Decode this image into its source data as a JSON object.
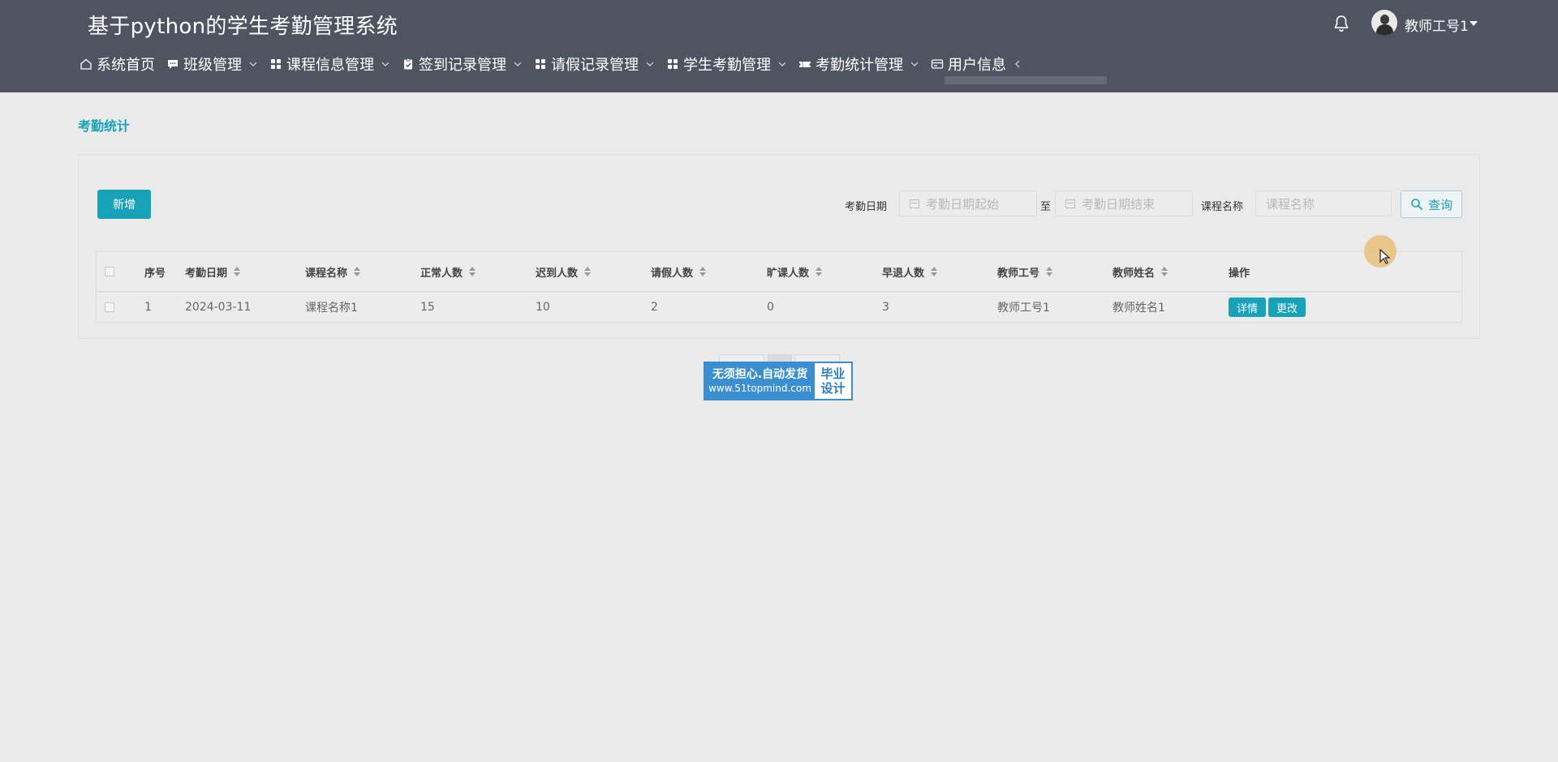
{
  "header": {
    "title": "基于python的学生考勤管理系统",
    "user_name": "教师工号1"
  },
  "nav": {
    "items": [
      {
        "label": "系统首页",
        "icon": "home-icon",
        "has_dropdown": false
      },
      {
        "label": "班级管理",
        "icon": "chat-icon",
        "has_dropdown": true
      },
      {
        "label": "课程信息管理",
        "icon": "grid-icon",
        "has_dropdown": true
      },
      {
        "label": "签到记录管理",
        "icon": "clipboard-check-icon",
        "has_dropdown": true
      },
      {
        "label": "请假记录管理",
        "icon": "grid-icon",
        "has_dropdown": true
      },
      {
        "label": "学生考勤管理",
        "icon": "grid-icon",
        "has_dropdown": true
      },
      {
        "label": "考勤统计管理",
        "icon": "ticket-icon",
        "has_dropdown": true
      },
      {
        "label": "用户信息",
        "icon": "card-icon",
        "has_dropdown": true
      }
    ]
  },
  "breadcrumb": "考勤统计",
  "toolbar": {
    "add_label": "新增",
    "date_label": "考勤日期",
    "date_start_placeholder": "考勤日期起始",
    "date_to": "至",
    "date_end_placeholder": "考勤日期结束",
    "course_label": "课程名称",
    "course_placeholder": "课程名称",
    "query_label": "查询"
  },
  "table": {
    "columns": [
      "序号",
      "考勤日期",
      "课程名称",
      "正常人数",
      "迟到人数",
      "请假人数",
      "旷课人数",
      "早退人数",
      "教师工号",
      "教师姓名",
      "操作"
    ],
    "rows": [
      {
        "index": "1",
        "date": "2024-03-11",
        "course": "课程名称1",
        "normal": "15",
        "late": "10",
        "leave": "2",
        "absent": "0",
        "early": "3",
        "teacher_id": "教师工号1",
        "teacher_name": "教师姓名1",
        "actions": [
          "详情",
          "更改"
        ]
      }
    ]
  },
  "watermark": {
    "line1": "无须担心.自动发货",
    "line2": "www.51topmind.com",
    "right1": "毕业",
    "right2": "设计"
  },
  "colors": {
    "header_bg": "#4f5461",
    "accent": "#17a2b8",
    "page_bg": "#ebebeb"
  }
}
